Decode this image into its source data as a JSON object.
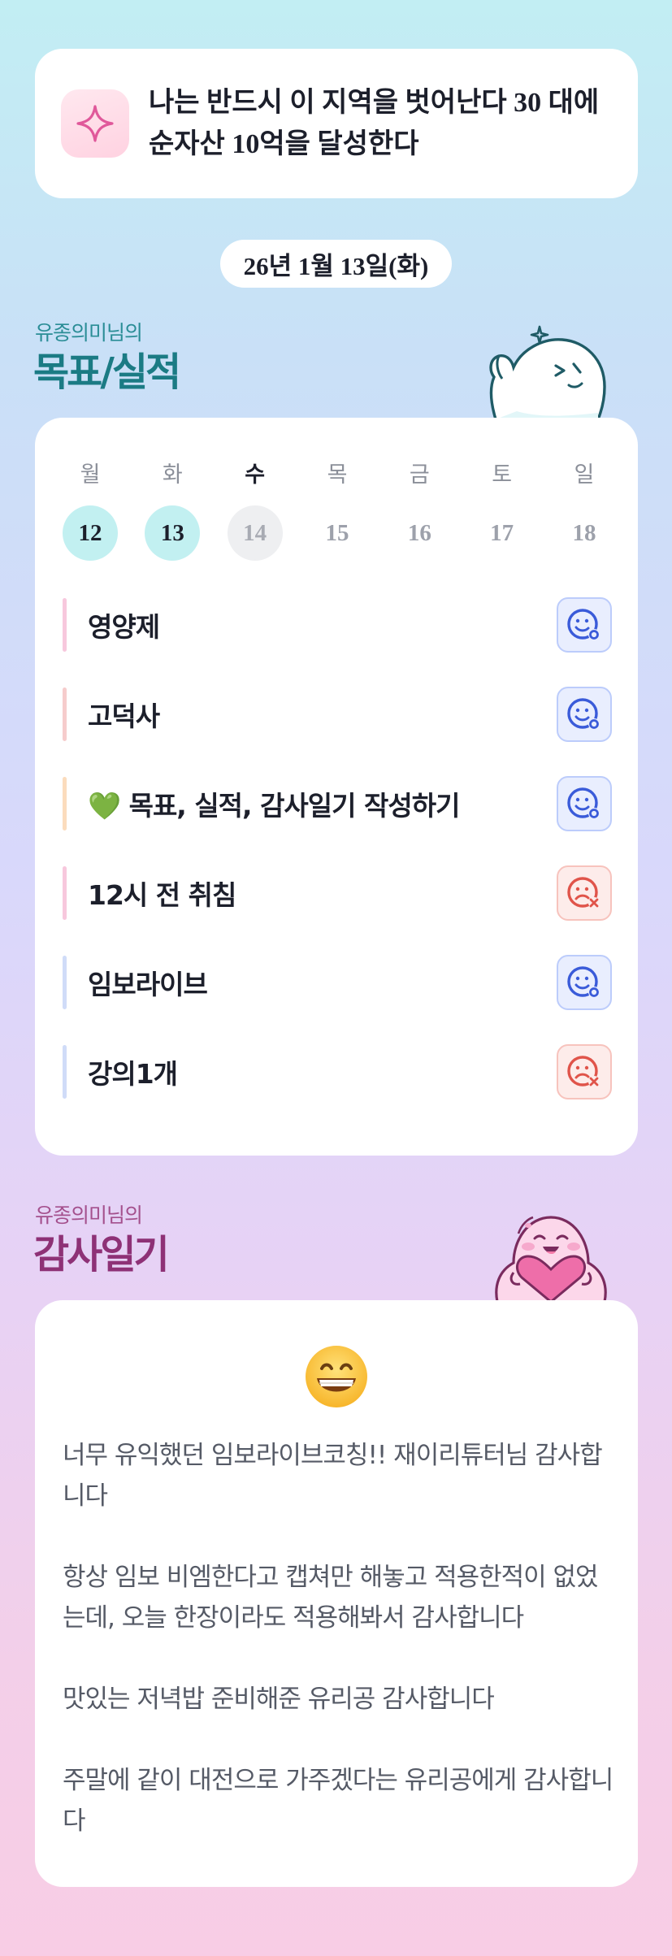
{
  "goal_banner": {
    "icon": "sparkle-icon",
    "text": "나는 반드시 이 지역을 벗어난다 30 대에 순자산 10억을 달성한다"
  },
  "date": "26년 1월 13일(화)",
  "goals_section": {
    "subtitle": "유종의미님의",
    "title": "목표/실적"
  },
  "week": {
    "days": [
      {
        "weekday": "월",
        "date": "12",
        "state": "done"
      },
      {
        "weekday": "화",
        "date": "13",
        "state": "done"
      },
      {
        "weekday": "수",
        "date": "14",
        "state": "today"
      },
      {
        "weekday": "목",
        "date": "15",
        "state": "future"
      },
      {
        "weekday": "금",
        "date": "16",
        "state": "future"
      },
      {
        "weekday": "토",
        "date": "17",
        "state": "future"
      },
      {
        "weekday": "일",
        "date": "18",
        "state": "future"
      }
    ]
  },
  "tasks": [
    {
      "label": "영양제",
      "status": "success",
      "bar_color": "#f7c8dd"
    },
    {
      "label": "고덕사",
      "status": "success",
      "bar_color": "#f6cccc"
    },
    {
      "label": "💚 목표, 실적, 감사일기 작성하기",
      "status": "success",
      "bar_color": "#fbdcbd"
    },
    {
      "label": "12시 전 취침",
      "status": "fail",
      "bar_color": "#f7c8dd"
    },
    {
      "label": "임보라이브",
      "status": "success",
      "bar_color": "#d0dcf8"
    },
    {
      "label": "강의1개",
      "status": "fail",
      "bar_color": "#d0dcf8"
    }
  ],
  "diary_section": {
    "subtitle": "유종의미님의",
    "title": "감사일기"
  },
  "diary": {
    "emoji": "grinning-face-icon",
    "paragraphs": [
      "너무 유익했던 임보라이브코칭!! 재이리튜터님 감사합니다",
      "항상 임보 비엠한다고 캡쳐만 해놓고 적용한적이 없었는데, 오늘 한장이라도 적용해봐서 감사합니다",
      "맛있는 저녁밥 준비해준 유리공 감사합니다",
      "주말에 같이 대전으로 가주겠다는 유리공에게 감사합니다"
    ]
  },
  "colors": {
    "teal_title": "#1b7b84",
    "magenta_title": "#8e3176",
    "success_blue": "#3a5bd9",
    "fail_red": "#e0544a",
    "done_day": "#c2f0f1"
  }
}
